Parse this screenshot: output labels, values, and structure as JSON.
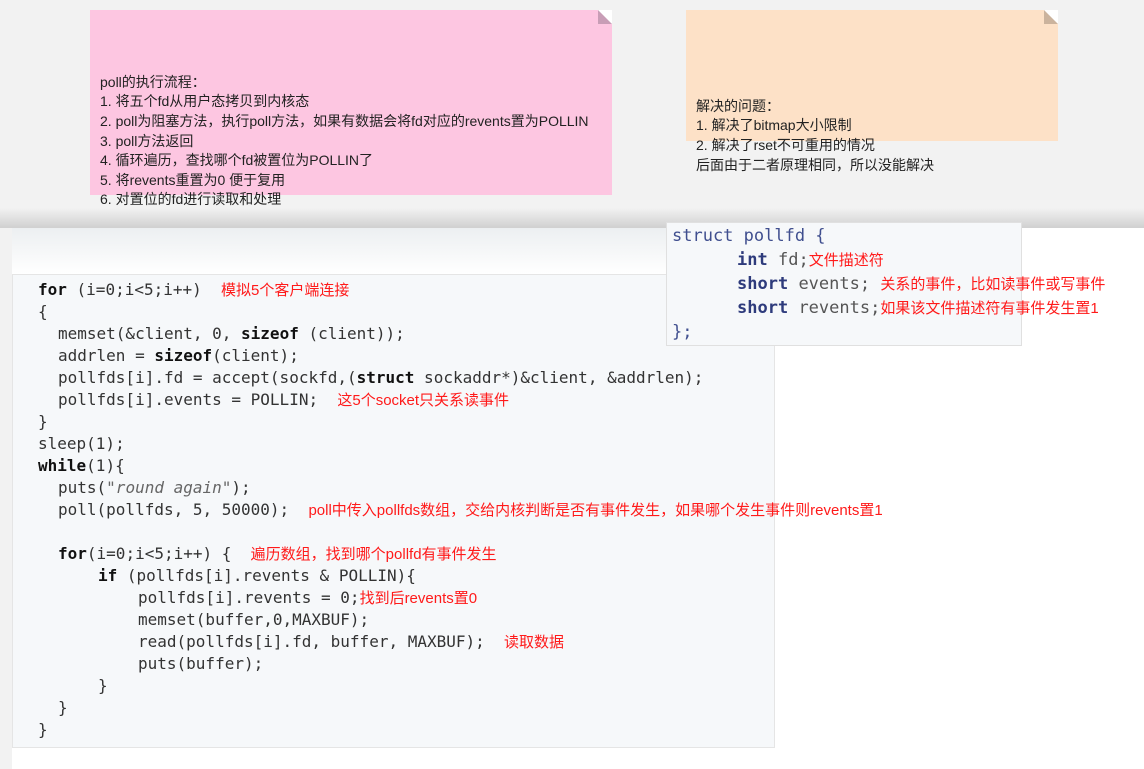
{
  "notes": {
    "pink": {
      "text": "poll的执行流程：\n1. 将五个fd从用户态拷贝到内核态\n2. poll为阻塞方法，执行poll方法，如果有数据会将fd对应的revents置为POLLIN\n3. poll方法返回\n4. 循环遍历，查找哪个fd被置位为POLLIN了\n5. 将revents重置为0 便于复用\n6. 对置位的fd进行读取和处理"
    },
    "orange": {
      "text": "解决的问题：\n1. 解决了bitmap大小限制\n2. 解决了rset不可重用的情况\n后面由于二者原理相同，所以没能解决"
    }
  },
  "struct": {
    "header": "struct pollfd {",
    "fd_type": "int",
    "fd_name": "fd;",
    "fd_note": "文件描述符",
    "events_type": "short",
    "events_name": "events;",
    "events_note": "关系的事件，比如读事件或写事件",
    "revents_type": "short",
    "revents_name": "revents;",
    "revents_note": "如果该文件描述符有事件发生置1",
    "close": "};"
  },
  "code": {
    "l1_kw": "for",
    "l1_rest": " (i=0;i<5;i++)",
    "l1_note": "模拟5个客户端连接",
    "l2": "{",
    "l3a": "memset(&client, 0, ",
    "l3kw": "sizeof",
    "l3b": " (client));",
    "l4a": "addrlen = ",
    "l4kw": "sizeof",
    "l4b": "(client);",
    "l5a": "pollfds[i].fd = accept(sockfd,(",
    "l5kw": "struct",
    "l5b": " sockaddr*)&client, &addrlen);",
    "l6": "pollfds[i].events = POLLIN;",
    "l6_note": "这5个socket只关系读事件",
    "l7": "}",
    "l8": "sleep(1);",
    "l9kw": "while",
    "l9b": "(1){",
    "l10a": "puts(",
    "l10s": "\"round again\"",
    "l10b": ");",
    "l11": "poll(pollfds, 5, 50000);",
    "l11_note": "poll中传入pollfds数组，交给内核判断是否有事件发生，如果哪个发生事件则revents置1",
    "l12kw": "for",
    "l12b": "(i=0;i<5;i++) {",
    "l12_note": "遍历数组，找到哪个pollfd有事件发生",
    "l13kw": "if",
    "l13b": " (pollfds[i].revents & POLLIN){",
    "l14": "pollfds[i].revents = 0;",
    "l14_note": "找到后revents置0",
    "l15": "memset(buffer,0,MAXBUF);",
    "l16": "read(pollfds[i].fd, buffer, MAXBUF);",
    "l16_note": "读取数据",
    "l17": "puts(buffer);",
    "l18": "}",
    "l19": "}",
    "l20": "}"
  }
}
